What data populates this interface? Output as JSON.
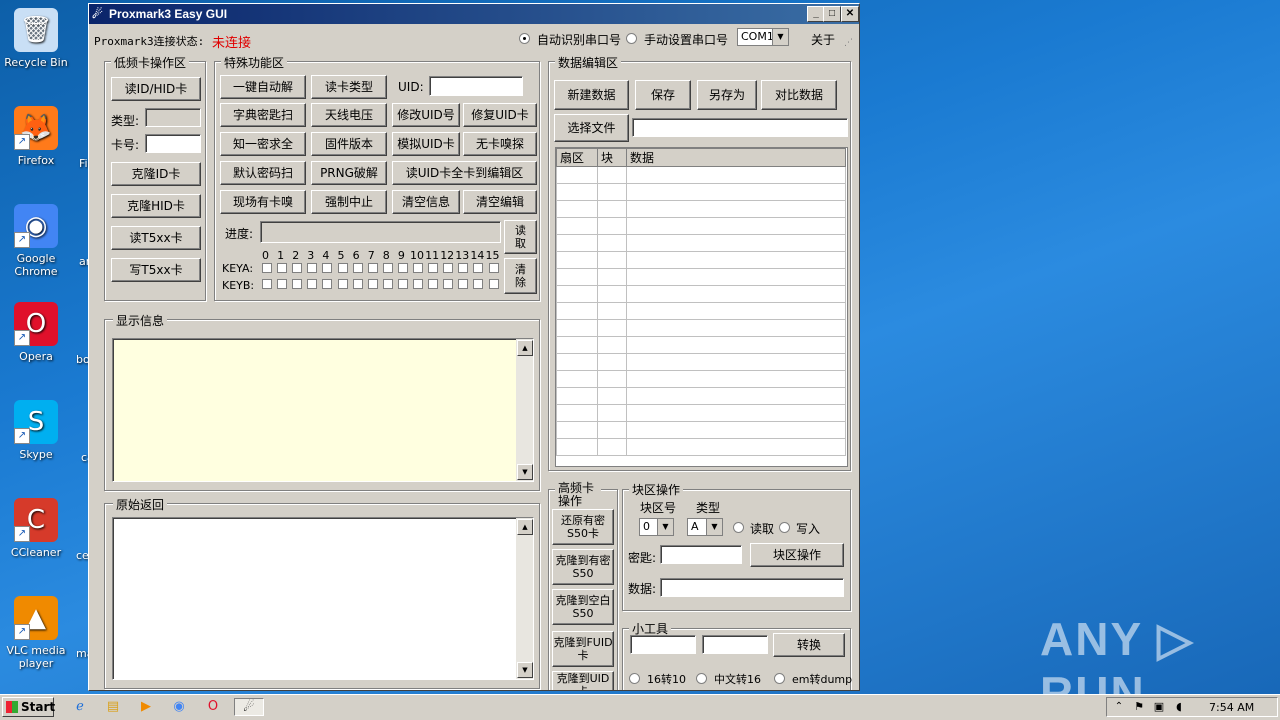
{
  "desktop": {
    "icons": [
      {
        "label": "Recycle Bin",
        "glyph": "🗑",
        "color": "#c9dff5"
      },
      {
        "label": "Firefox",
        "glyph": "🦊",
        "color": "#ff7a1a"
      },
      {
        "label": "Google Chrome",
        "glyph": "◉",
        "color": "#4285f4"
      },
      {
        "label": "Opera",
        "glyph": "O",
        "color": "#e0102b"
      },
      {
        "label": "Skype",
        "glyph": "S",
        "color": "#00aff0"
      },
      {
        "label": "CCleaner",
        "glyph": "C",
        "color": "#d63a2a"
      },
      {
        "label": "VLC media player",
        "glyph": "▲",
        "color": "#f08a00"
      }
    ],
    "partial_labels": [
      "Fi",
      "an",
      "bo",
      "ca",
      "ce",
      "ma"
    ],
    "watermark": "ANY ▷ RUN"
  },
  "window": {
    "title": "Proxmark3 Easy GUI",
    "status_label": "Proxmark3连接状态:",
    "status_value": "未连接",
    "status_color": "#e00000",
    "radio_auto": "自动识别串口号",
    "radio_manual": "手动设置串口号",
    "com_port": "COM1",
    "about": "关于"
  },
  "lf": {
    "title": "低频卡操作区",
    "read_btn": "读ID/HID卡",
    "type_label": "类型:",
    "card_label": "卡号:",
    "clone_id": "克隆ID卡",
    "clone_hid": "克隆HID卡",
    "read_t5": "读T5xx卡",
    "write_t5": "写T5xx卡"
  },
  "special": {
    "title": "特殊功能区",
    "b1": "一键自动解",
    "b2": "读卡类型",
    "uid_label": "UID:",
    "b3": "字典密匙扫",
    "b4": "天线电压",
    "b5": "修改UID号",
    "b6": "修复UID卡",
    "b7": "知一密求全",
    "b8": "固件版本",
    "b9": "模拟UID卡",
    "b10": "无卡嗅探",
    "b11": "默认密码扫",
    "b12": "PRNG破解",
    "b13": "读UID卡全卡到编辑区",
    "b14": "现场有卡嗅",
    "b15": "强制中止",
    "b16": "清空信息",
    "b17": "清空编辑",
    "progress_label": "进度:",
    "read_btn": "读取",
    "clear_btn": "清除",
    "keya": "KEYA:",
    "keyb": "KEYB:",
    "sectors": [
      "0",
      "1",
      "2",
      "3",
      "4",
      "5",
      "6",
      "7",
      "8",
      "9",
      "10",
      "11",
      "12",
      "13",
      "14",
      "15"
    ]
  },
  "display": {
    "title": "显示信息"
  },
  "raw": {
    "title": "原始返回"
  },
  "editor": {
    "title": "数据编辑区",
    "new": "新建数据",
    "save": "保存",
    "save_as": "另存为",
    "compare": "对比数据",
    "choose_file": "选择文件",
    "columns": [
      "扇区",
      "块",
      "数据"
    ]
  },
  "hf": {
    "title": "高频卡操作",
    "b1": "还原有密S50卡",
    "b2": "克隆到有密S50",
    "b3": "克隆到空白S50",
    "b4": "克隆到FUID卡",
    "b5": "克隆到UID卡"
  },
  "block": {
    "title": "块区操作",
    "block_no_label": "块区号",
    "type_label": "类型",
    "block_no": "0",
    "key_type": "A",
    "read": "读取",
    "write": "写入",
    "key_label": "密匙:",
    "op_btn": "块区操作",
    "data_label": "数据:"
  },
  "tools": {
    "title": "小工具",
    "convert": "转换",
    "r1": "16转10",
    "r2": "中文转16",
    "r3": "em转dump"
  },
  "taskbar": {
    "start": "Start",
    "time": "7:54 AM"
  }
}
